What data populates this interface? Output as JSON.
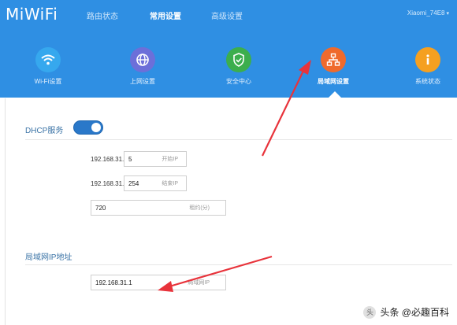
{
  "header": {
    "logo": "MiWiFi",
    "tabs": [
      {
        "label": "路由状态"
      },
      {
        "label": "常用设置"
      },
      {
        "label": "高级设置"
      }
    ],
    "device_name": "Xiaomi_74E8",
    "device_caret": "▾"
  },
  "tiles": [
    {
      "label": "Wi-Fi设置",
      "icon": "wifi-icon",
      "color": "#36a8ee"
    },
    {
      "label": "上网设置",
      "icon": "globe-icon",
      "color": "#6c6fd9"
    },
    {
      "label": "安全中心",
      "icon": "shield-icon",
      "color": "#3cae4d"
    },
    {
      "label": "局域网设置",
      "icon": "network-icon",
      "color": "#ef6a2c"
    },
    {
      "label": "系统状态",
      "icon": "info-icon",
      "color": "#f5a020"
    }
  ],
  "dhcp": {
    "title": "DHCP服务",
    "enabled": true,
    "start": {
      "prefix": "192.168.31.",
      "value": "5",
      "hint": "开始IP"
    },
    "end": {
      "prefix": "192.168.31.",
      "value": "254",
      "hint": "结束IP"
    },
    "lease": {
      "value": "720",
      "hint": "租约(分)"
    }
  },
  "lan_ip": {
    "title": "局域网IP地址",
    "value": "192.168.31.1",
    "hint": "局域网IP"
  },
  "colors": {
    "header_bg": "#2f8fe3",
    "accent": "#2a78c9",
    "annotation_arrow": "#e8333b"
  },
  "watermark": "头条 @必趣百科"
}
